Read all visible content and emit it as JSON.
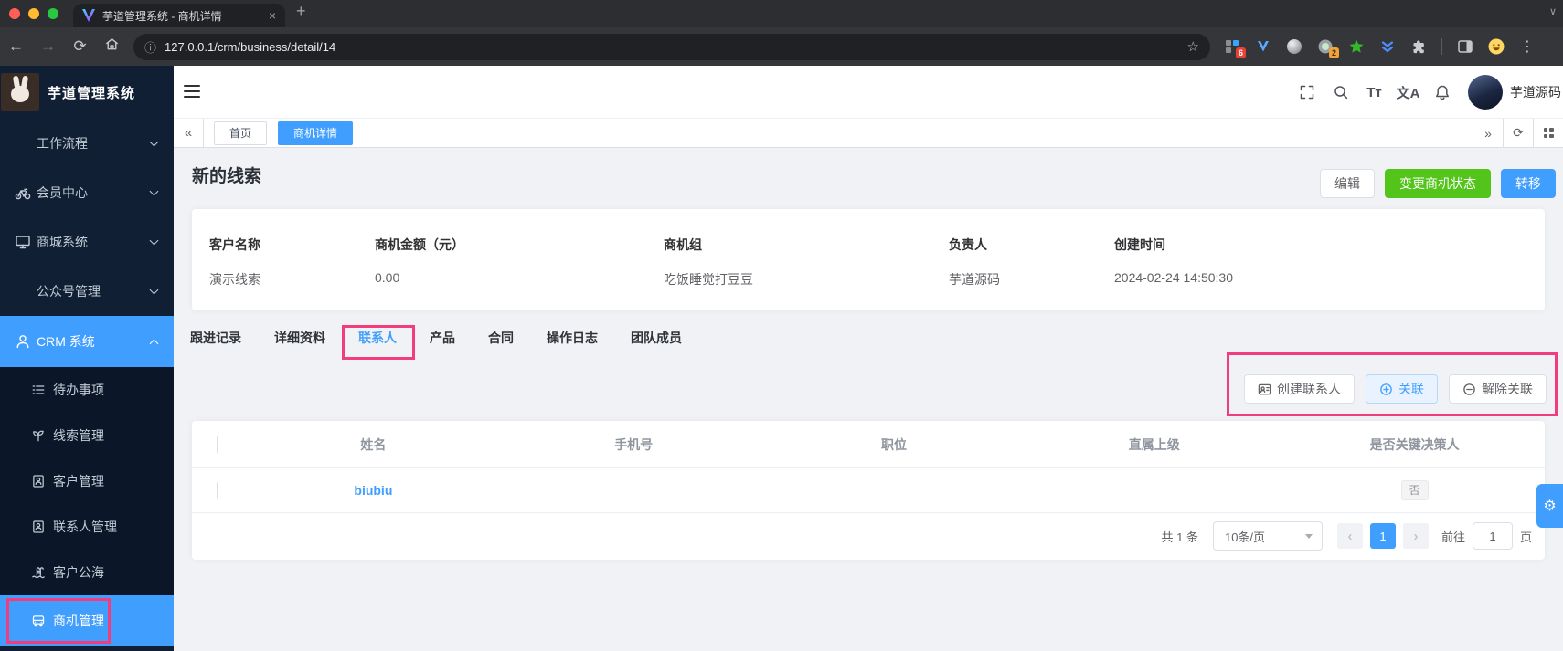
{
  "chrome": {
    "tab_title": "芋道管理系统 - 商机详情",
    "url": "127.0.0.1/crm/business/detail/14",
    "ext_badge_red": "6",
    "ext_badge_orange": "2"
  },
  "icons": {
    "close": "×",
    "new_tab": "+",
    "tab_caret": "∨",
    "back": "←",
    "forward": "→",
    "reload": "⟳",
    "info": "ⓘ",
    "star": "☆",
    "menu_dots": "⋮",
    "collapse": "«",
    "expand": "»",
    "refresh": "⟳",
    "font_size": "Tт",
    "language": "文A",
    "prev": "‹",
    "next": "›",
    "gear": "⚙"
  },
  "sidebar": {
    "app_title": "芋道管理系统",
    "items": [
      {
        "label": "工作流程"
      },
      {
        "label": "会员中心"
      },
      {
        "label": "商城系统"
      },
      {
        "label": "公众号管理"
      },
      {
        "label": "CRM 系统"
      }
    ],
    "crm_children": [
      {
        "label": "待办事项"
      },
      {
        "label": "线索管理"
      },
      {
        "label": "客户管理"
      },
      {
        "label": "联系人管理"
      },
      {
        "label": "客户公海"
      },
      {
        "label": "商机管理"
      }
    ]
  },
  "navbar": {
    "username": "芋道源码"
  },
  "tags_view": {
    "tabs": [
      {
        "label": "首页"
      },
      {
        "label": "商机详情"
      }
    ]
  },
  "page": {
    "title": "新的线索",
    "actions": {
      "edit": "编辑",
      "change_status": "变更商机状态",
      "transfer": "转移"
    },
    "info_fields": [
      {
        "label": "客户名称",
        "value": "演示线索"
      },
      {
        "label": "商机金额（元）",
        "value": "0.00"
      },
      {
        "label": "商机组",
        "value": "吃饭睡觉打豆豆"
      },
      {
        "label": "负责人",
        "value": "芋道源码"
      },
      {
        "label": "创建时间",
        "value": "2024-02-24 14:50:30"
      }
    ],
    "tabs": [
      {
        "label": "跟进记录"
      },
      {
        "label": "详细资料"
      },
      {
        "label": "联系人"
      },
      {
        "label": "产品"
      },
      {
        "label": "合同"
      },
      {
        "label": "操作日志"
      },
      {
        "label": "团队成员"
      }
    ],
    "toolbar": {
      "create_contact": "创建联系人",
      "link": "关联",
      "unlink": "解除关联"
    },
    "table": {
      "columns": [
        "姓名",
        "手机号",
        "职位",
        "直属上级",
        "是否关键决策人"
      ],
      "rows": [
        {
          "name": "biubiu",
          "mobile": "",
          "post": "",
          "parent": "",
          "master": "否"
        }
      ]
    },
    "pagination": {
      "total": "共 1 条",
      "page_size": "10条/页",
      "current": "1",
      "goto_label": "前往",
      "goto_value": "1",
      "unit_label": "页"
    }
  },
  "colors": {
    "primary": "#409eff",
    "success": "#52c41a",
    "annotation": "#f23d7c"
  }
}
